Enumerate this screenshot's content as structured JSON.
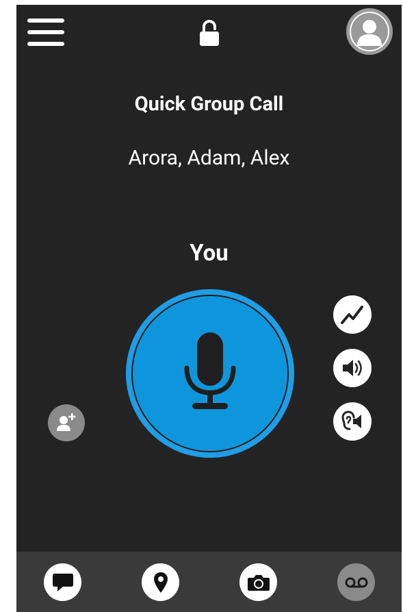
{
  "header": {
    "menu_icon": "hamburger-menu-icon",
    "lock_icon": "unlocked-padlock-icon",
    "profile_icon": "user-avatar-icon"
  },
  "call": {
    "title": "Quick Group Call",
    "participants": "Arora, Adam, Alex",
    "speaker": "You"
  },
  "controls": {
    "ptt_icon": "microphone-icon",
    "add_participant_icon": "add-user-icon",
    "side_buttons": [
      {
        "name": "signal-quality-icon"
      },
      {
        "name": "speaker-volume-icon"
      },
      {
        "name": "earpiece-icon"
      }
    ]
  },
  "bottom_nav": [
    {
      "name": "chat-icon"
    },
    {
      "name": "location-pin-icon"
    },
    {
      "name": "camera-icon"
    },
    {
      "name": "voicemail-icon"
    }
  ],
  "colors": {
    "background": "#232323",
    "ptt_outer": "#1e9ee6",
    "ptt_inner": "#0d96dc",
    "bottom_bar": "#3a3a3a",
    "disabled_icon": "#8a8a8a"
  }
}
